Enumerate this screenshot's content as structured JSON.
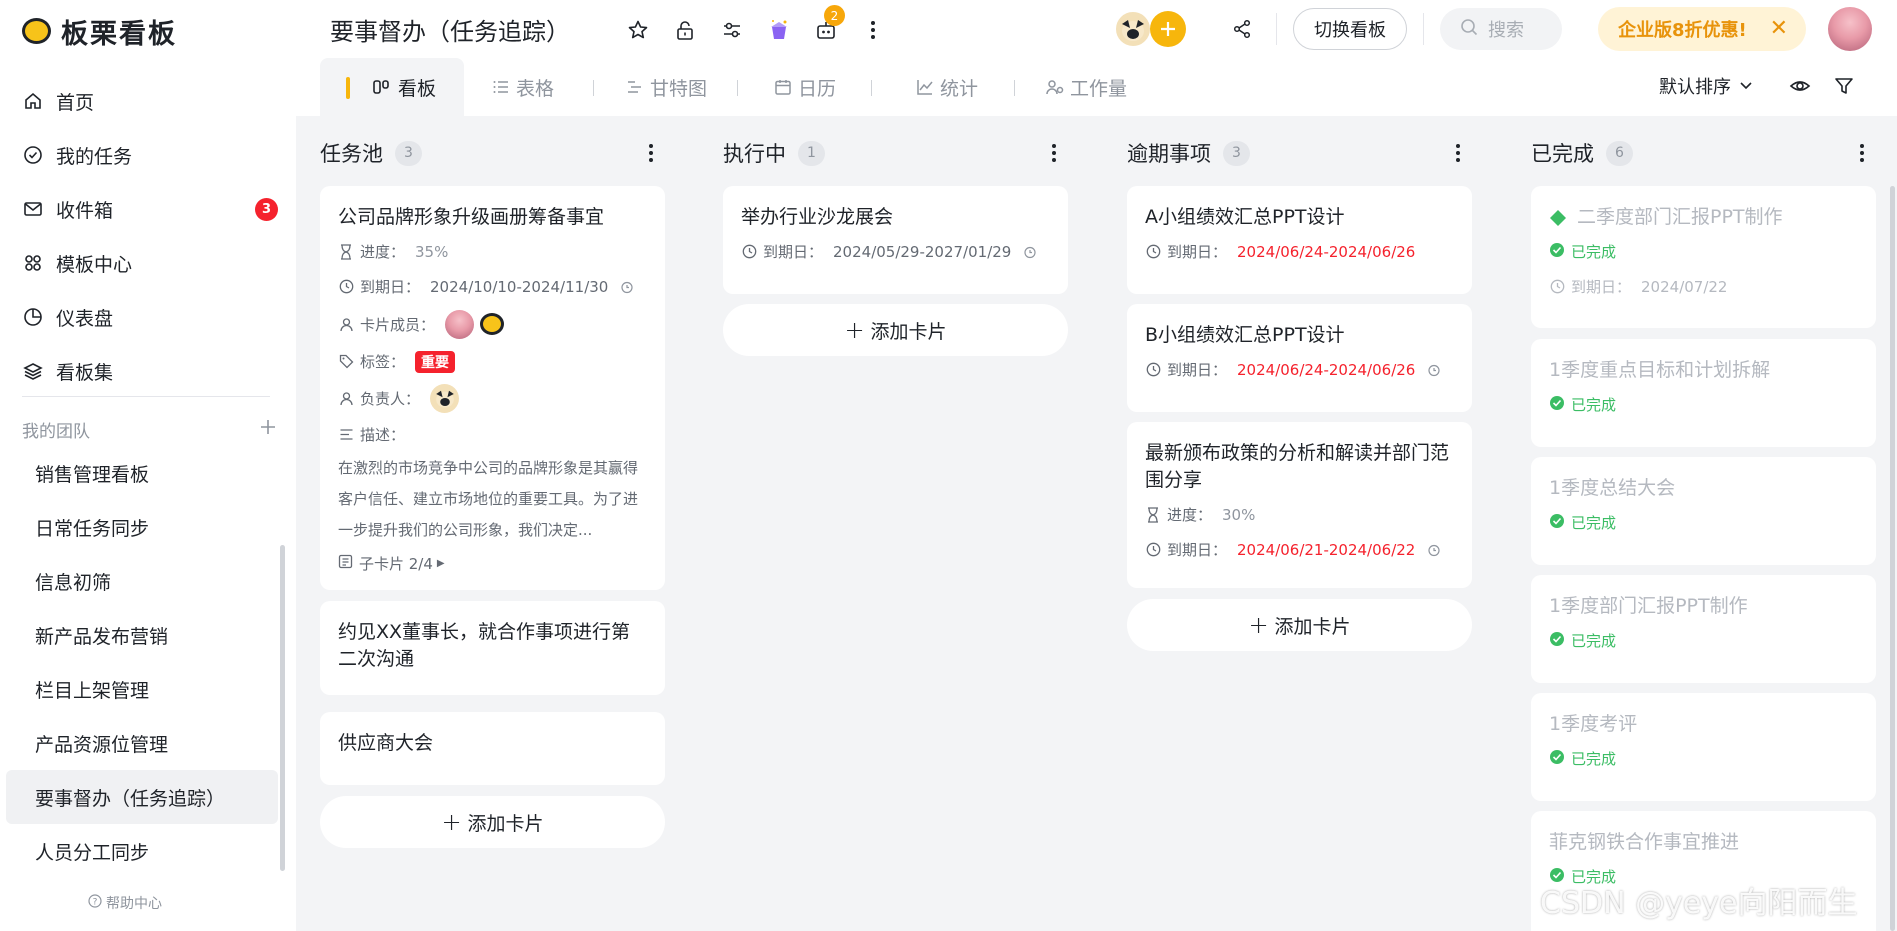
{
  "app": {
    "name": "板栗看板",
    "brand_color": "#f7b60c"
  },
  "sidebar": {
    "items": [
      {
        "label": "首页",
        "icon": "home-icon"
      },
      {
        "label": "我的任务",
        "icon": "check-circle-icon"
      },
      {
        "label": "收件箱",
        "icon": "mail-icon",
        "badge": "3"
      },
      {
        "label": "模板中心",
        "icon": "template-icon"
      },
      {
        "label": "仪表盘",
        "icon": "pie-chart-icon"
      },
      {
        "label": "看板集",
        "icon": "layers-icon"
      }
    ],
    "team_heading": "我的团队",
    "team_items": [
      "销售管理看板",
      "日常任务同步",
      "信息初筛",
      "新产品发布营销",
      "栏目上架管理",
      "产品资源位管理",
      "要事督办（任务追踪）",
      "人员分工同步"
    ],
    "help": "帮助中心"
  },
  "header": {
    "board_title": "要事督办（任务追踪）",
    "robot_badge": "2",
    "switch_board": "切换看板",
    "search_placeholder": "搜索",
    "promo": "企业版8折优惠!"
  },
  "tabs": [
    {
      "label": "看板",
      "icon": "kanban-icon",
      "active": true
    },
    {
      "label": "表格",
      "icon": "list-icon"
    },
    {
      "label": "甘特图",
      "icon": "gantt-icon"
    },
    {
      "label": "日历",
      "icon": "calendar-icon"
    },
    {
      "label": "统计",
      "icon": "stats-icon"
    },
    {
      "label": "工作量",
      "icon": "workload-icon"
    }
  ],
  "toolbar": {
    "sort_label": "默认排序"
  },
  "labels": {
    "progress": "进度：",
    "due": "到期日：",
    "members": "卡片成员：",
    "tags": "标签：",
    "owner": "负责人：",
    "desc": "描述：",
    "add_card": "添加卡片",
    "done": "已完成"
  },
  "columns": [
    {
      "title": "任务池",
      "count": "3",
      "cards": [
        {
          "title": "公司品牌形象升级画册筹备事宜",
          "progress": "35%",
          "due": "2024/10/10-2024/11/30",
          "tag": "重要",
          "description": "在激烈的市场竞争中公司的品牌形象是其赢得客户信任、建立市场地位的重要工具。为了进一步提升我们的公司形象，我们决定...",
          "subcards": "子卡片 2/4"
        },
        {
          "title": "约见XX董事长，就合作事项进行第二次沟通"
        },
        {
          "title": "供应商大会"
        }
      ]
    },
    {
      "title": "执行中",
      "count": "1",
      "cards": [
        {
          "title": "举办行业沙龙展会",
          "due": "2024/05/29-2027/01/29"
        }
      ]
    },
    {
      "title": "逾期事项",
      "count": "3",
      "cards": [
        {
          "title": "A小组绩效汇总PPT设计",
          "due": "2024/06/24-2024/06/26"
        },
        {
          "title": "B小组绩效汇总PPT设计",
          "due": "2024/06/24-2024/06/26"
        },
        {
          "title": "最新颁布政策的分析和解读并部门范围分享",
          "progress": "30%",
          "due": "2024/06/21-2024/06/22"
        }
      ]
    },
    {
      "title": "已完成",
      "count": "6",
      "cards": [
        {
          "title": "二季度部门汇报PPT制作",
          "due": "2024/07/22"
        },
        {
          "title": "1季度重点目标和计划拆解"
        },
        {
          "title": "1季度总结大会"
        },
        {
          "title": "1季度部门汇报PPT制作"
        },
        {
          "title": "1季度考评"
        },
        {
          "title": "菲克钢铁合作事宜推进"
        }
      ]
    }
  ],
  "watermark": "CSDN @yeye向阳而生"
}
